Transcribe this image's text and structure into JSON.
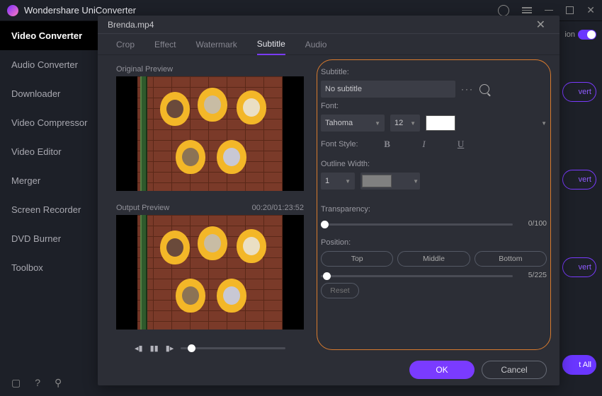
{
  "title": "Wondershare UniConverter",
  "nav": {
    "items": [
      "Video Converter",
      "Audio Converter",
      "Downloader",
      "Video Compressor",
      "Video Editor",
      "Merger",
      "Screen Recorder",
      "DVD Burner",
      "Toolbox"
    ],
    "active": 0
  },
  "rightEdge": {
    "switchLabel": "ion",
    "buttons": [
      "vert",
      "vert",
      "vert",
      "t All"
    ]
  },
  "modal": {
    "filename": "Brenda.mp4",
    "tabs": [
      "Crop",
      "Effect",
      "Watermark",
      "Subtitle",
      "Audio"
    ],
    "activeTab": 3,
    "previews": {
      "originalLabel": "Original Preview",
      "outputLabel": "Output Preview",
      "timecode": "00:20/01:23:52"
    },
    "settings": {
      "subtitleLabel": "Subtitle:",
      "subtitleValue": "No subtitle",
      "fontLabel": "Font:",
      "fontName": "Tahoma",
      "fontSize": "12",
      "fontStyleLabel": "Font Style:",
      "styleB": "B",
      "styleI": "I",
      "styleU": "U",
      "outlineLabel": "Outline Width:",
      "outlineValue": "1",
      "transparencyLabel": "Transparency:",
      "transparencyValue": "0/100",
      "positionLabel": "Position:",
      "posTop": "Top",
      "posMiddle": "Middle",
      "posBottom": "Bottom",
      "positionValue": "5/225",
      "reset": "Reset"
    },
    "ok": "OK",
    "cancel": "Cancel"
  }
}
